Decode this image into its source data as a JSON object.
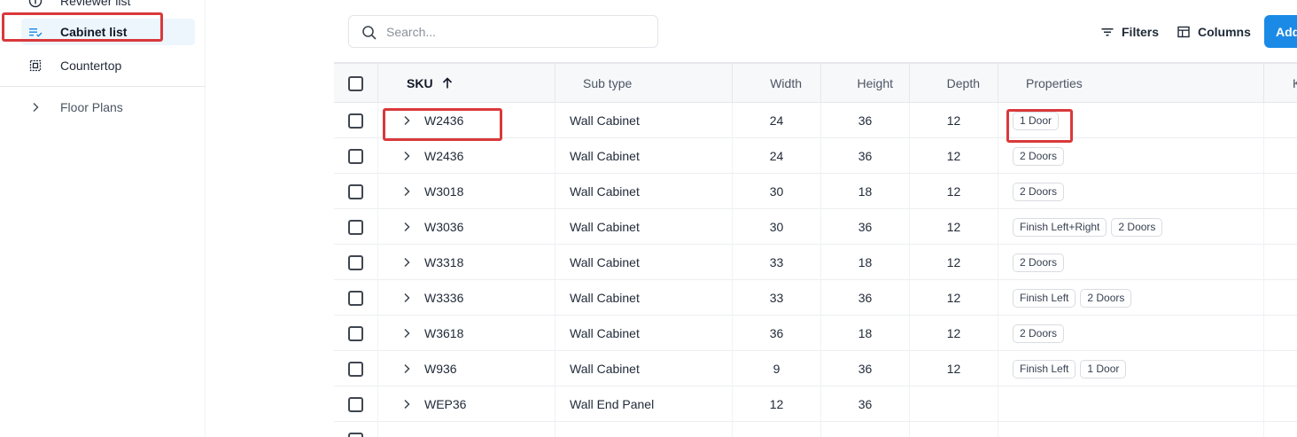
{
  "sidebar": {
    "items": [
      {
        "label": "Reviewer list",
        "icon": "info-circle-icon"
      },
      {
        "label": "Cabinet list",
        "icon": "sorted-list-icon",
        "active": true
      },
      {
        "label": "Countertop",
        "icon": "countertop-grid-icon"
      },
      {
        "label": "Floor Plans",
        "icon": "chevron-right-icon"
      }
    ]
  },
  "toolbar": {
    "search_placeholder": "Search...",
    "filters_label": "Filters",
    "columns_label": "Columns",
    "add_label": "Add"
  },
  "table": {
    "columns": [
      "SKU",
      "Sub type",
      "Width",
      "Height",
      "Depth",
      "Properties",
      "K"
    ],
    "sort_column": "SKU",
    "sort_direction": "ascending",
    "rows": [
      {
        "sku": "W2436",
        "subtype": "Wall Cabinet",
        "width": "24",
        "height": "36",
        "depth": "12",
        "properties": [
          "1 Door"
        ]
      },
      {
        "sku": "W2436",
        "subtype": "Wall Cabinet",
        "width": "24",
        "height": "36",
        "depth": "12",
        "properties": [
          "2 Doors"
        ]
      },
      {
        "sku": "W3018",
        "subtype": "Wall Cabinet",
        "width": "30",
        "height": "18",
        "depth": "12",
        "properties": [
          "2 Doors"
        ]
      },
      {
        "sku": "W3036",
        "subtype": "Wall Cabinet",
        "width": "30",
        "height": "36",
        "depth": "12",
        "properties": [
          "Finish Left+Right",
          "2 Doors"
        ]
      },
      {
        "sku": "W3318",
        "subtype": "Wall Cabinet",
        "width": "33",
        "height": "18",
        "depth": "12",
        "properties": [
          "2 Doors"
        ]
      },
      {
        "sku": "W3336",
        "subtype": "Wall Cabinet",
        "width": "33",
        "height": "36",
        "depth": "12",
        "properties": [
          "Finish Left",
          "2 Doors"
        ]
      },
      {
        "sku": "W3618",
        "subtype": "Wall Cabinet",
        "width": "36",
        "height": "18",
        "depth": "12",
        "properties": [
          "2 Doors"
        ]
      },
      {
        "sku": "W936",
        "subtype": "Wall Cabinet",
        "width": "9",
        "height": "36",
        "depth": "12",
        "properties": [
          "Finish Left",
          "1 Door"
        ]
      },
      {
        "sku": "WEP36",
        "subtype": "Wall End Panel",
        "width": "12",
        "height": "36",
        "depth": "",
        "properties": []
      },
      {
        "sku": "",
        "subtype": "",
        "width": "",
        "height": "",
        "depth": "",
        "properties": []
      }
    ]
  },
  "colors": {
    "accent": "#1a8ae6",
    "highlight": "#d9393b",
    "active_bg": "#eef6fd"
  }
}
